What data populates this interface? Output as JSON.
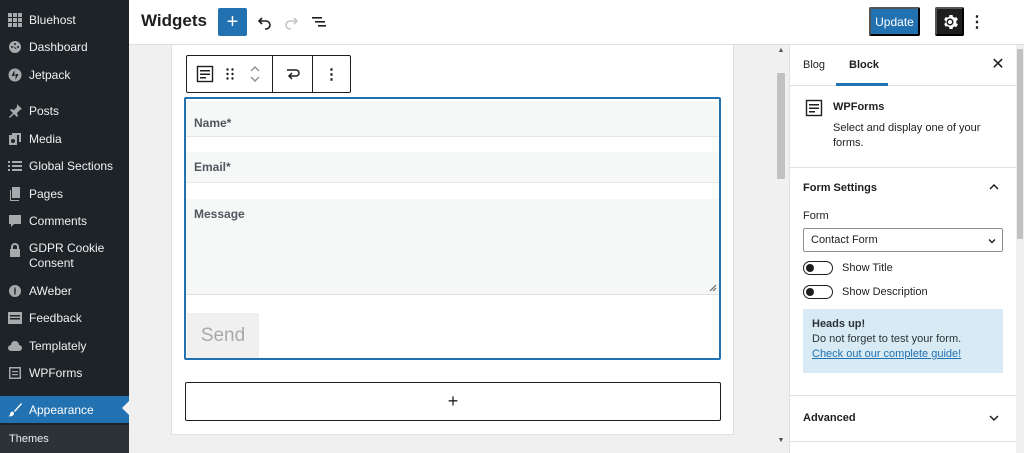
{
  "sidebar": {
    "items": [
      {
        "label": "Bluehost",
        "icon": "grid-icon"
      },
      {
        "label": "Dashboard",
        "icon": "dashboard-icon"
      },
      {
        "label": "Jetpack",
        "icon": "jetpack-icon"
      },
      {
        "label": "Posts",
        "icon": "pin-icon"
      },
      {
        "label": "Media",
        "icon": "media-icon"
      },
      {
        "label": "Global Sections",
        "icon": "list-icon"
      },
      {
        "label": "Pages",
        "icon": "pages-icon"
      },
      {
        "label": "Comments",
        "icon": "comment-icon"
      },
      {
        "label": "GDPR Cookie Consent",
        "icon": "lock-icon"
      },
      {
        "label": "AWeber",
        "icon": "aweber-icon"
      },
      {
        "label": "Feedback",
        "icon": "feedback-icon"
      },
      {
        "label": "Templately",
        "icon": "templately-icon"
      },
      {
        "label": "WPForms",
        "icon": "wpforms-icon"
      },
      {
        "label": "Appearance",
        "icon": "brush-icon",
        "active": true
      }
    ],
    "submenu": {
      "label": "Themes"
    }
  },
  "header": {
    "title": "Widgets",
    "add_label": "+",
    "update_label": "Update",
    "more_label": "⋮"
  },
  "form_block": {
    "fields": [
      {
        "label": "Name*"
      },
      {
        "label": "Email*"
      },
      {
        "label": "Message"
      }
    ],
    "send_label": "Send"
  },
  "canvas": {
    "append_label": "+"
  },
  "inspector": {
    "tabs": [
      {
        "label": "Blog"
      },
      {
        "label": "Block",
        "active": true
      }
    ],
    "close_label": "✕",
    "block_card": {
      "title": "WPForms",
      "description": "Select and display one of your forms."
    },
    "form_settings": {
      "title": "Form Settings",
      "form_label": "Form",
      "selected_form": "Contact Form",
      "toggles": [
        {
          "label": "Show Title",
          "on": false
        },
        {
          "label": "Show Description",
          "on": false
        }
      ],
      "notice": {
        "title": "Heads up!",
        "text": "Do not forget to test your form.",
        "link": "Check out our complete guide!"
      }
    },
    "advanced": {
      "title": "Advanced"
    }
  },
  "colors": {
    "accent": "#2271b1",
    "sidebar_bg": "#1d2327",
    "notice_bg": "#d8eaf4"
  }
}
